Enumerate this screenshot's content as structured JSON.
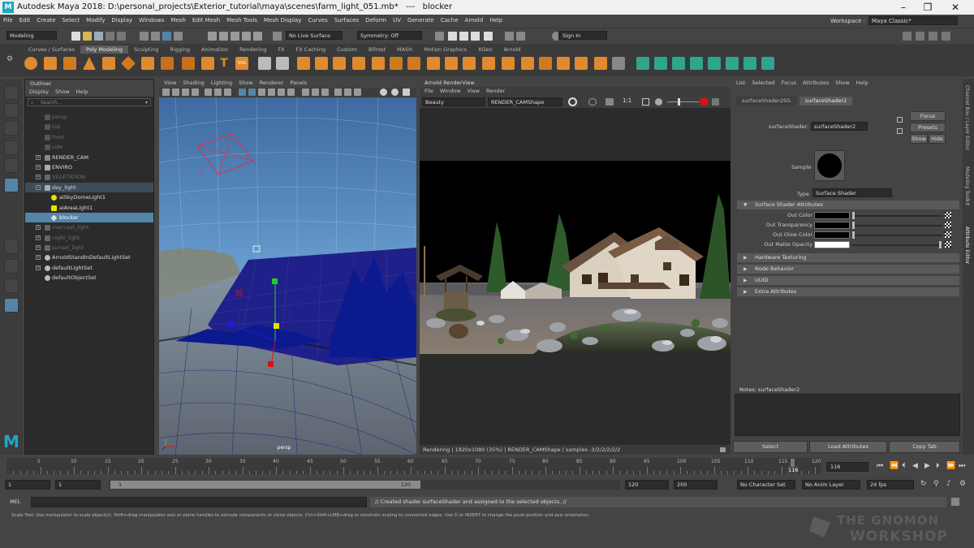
{
  "title_bar": {
    "text": "Autodesk Maya 2018: D:\\personal_projects\\Exterior_tutorial\\maya\\scenes\\farm_light_051.mb*   ---   blocker",
    "logo": "M"
  },
  "menu": {
    "items": [
      "File",
      "Edit",
      "Create",
      "Select",
      "Modify",
      "Display",
      "Windows",
      "Mesh",
      "Edit Mesh",
      "Mesh Tools",
      "Mesh Display",
      "Curves",
      "Surfaces",
      "Deform",
      "UV",
      "Generate",
      "Cache",
      "Arnold",
      "Help"
    ],
    "workspace_label": "Workspace :",
    "workspace_value": "Maya Classic*"
  },
  "status_line": {
    "mode": "Modeling",
    "live_surface": "No Live Surface",
    "symmetry": "Symmetry: Off",
    "sign_in": "Sign In"
  },
  "shelf": {
    "tabs": [
      "Curves / Surfaces",
      "Poly Modeling",
      "Sculpting",
      "Rigging",
      "Animation",
      "Rendering",
      "FX",
      "FX Caching",
      "Custom",
      "Bifrost",
      "MASH",
      "Motion Graphics",
      "XGen",
      "Arnold"
    ],
    "active_tab": "Poly Modeling",
    "text_icons": {
      "text": "T",
      "svg": "SVG"
    }
  },
  "outliner": {
    "title": "Outliner",
    "menu": [
      "Display",
      "Show",
      "Help"
    ],
    "search_placeholder": "Search...",
    "items": [
      {
        "label": "persp",
        "dim": true
      },
      {
        "label": "top",
        "dim": true
      },
      {
        "label": "front",
        "dim": true
      },
      {
        "label": "side",
        "dim": true
      },
      {
        "label": "RENDER_CAM"
      },
      {
        "label": "ENVIRO"
      },
      {
        "label": "VEGETATION",
        "dim": true
      },
      {
        "label": "day_light"
      },
      {
        "label": "aiSkyDomeLight1"
      },
      {
        "label": "aiAreaLight1"
      },
      {
        "label": "blocker",
        "selected": true
      },
      {
        "label": "overcast_light",
        "dim": true
      },
      {
        "label": "night_light",
        "dim": true
      },
      {
        "label": "sunset_light",
        "dim": true
      },
      {
        "label": "ArnoldStandInDefaultLightSet"
      },
      {
        "label": "defaultLightSet"
      },
      {
        "label": "defaultObjectSet"
      }
    ]
  },
  "viewport": {
    "menu": [
      "View",
      "Shading",
      "Lighting",
      "Show",
      "Renderer",
      "Panels"
    ],
    "camera_label": "persp"
  },
  "render_view": {
    "title": "Arnold RenderView",
    "menu": [
      "File",
      "Window",
      "View",
      "Render"
    ],
    "aov": "Beauty",
    "camera": "RENDER_CAMShape",
    "ratio": "1:1",
    "status": "Rendering | 1920x1080 (35%) | RENDER_CAMShape | samples -3/2/2/2/2/2"
  },
  "attribute_editor": {
    "menu": [
      "List",
      "Selected",
      "Focus",
      "Attributes",
      "Show",
      "Help"
    ],
    "tabs": [
      "surfaceShader2SG",
      "surfaceShader2"
    ],
    "active_tab": "surfaceShader2",
    "node_label": "surfaceShader:",
    "node_name": "surfaceShader2",
    "buttons": {
      "focus": "Focus",
      "presets": "Presets",
      "show": "Show",
      "hide": "Hide"
    },
    "sample_label": "Sample",
    "type_label": "Type",
    "type_value": "Surface Shader",
    "section_main": "Surface Shader Attributes",
    "attributes": [
      {
        "label": "Out Color",
        "color": "#000000",
        "value": 0.0
      },
      {
        "label": "Out Transparency",
        "color": "#000000",
        "value": 0.0
      },
      {
        "label": "Out Glow Color",
        "color": "#000000",
        "value": 0.0
      },
      {
        "label": "Out Matte Opacity",
        "color": "#ffffff",
        "value": 1.0
      }
    ],
    "collapsed_sections": [
      "Hardware Texturing",
      "Node Behavior",
      "UUID",
      "Extra Attributes"
    ],
    "notes_label": "Notes:  surfaceShader2",
    "bottom_buttons": [
      "Select",
      "Load Attributes",
      "Copy Tab"
    ]
  },
  "side_tabs": [
    "Channel Box / Layer Editor",
    "Modeling Toolkit",
    "Attribute Editor"
  ],
  "time_slider": {
    "ticks": [
      "5",
      "10",
      "15",
      "20",
      "25",
      "30",
      "35",
      "40",
      "45",
      "50",
      "55",
      "60",
      "65",
      "70",
      "75",
      "80",
      "85",
      "90",
      "95",
      "100",
      "105",
      "110",
      "115",
      "120"
    ],
    "current_frame": "116",
    "current_field": "116"
  },
  "range_bar": {
    "start": "1",
    "playback_start": "1",
    "range_start": "1",
    "range_end": "120",
    "playback_end": "120",
    "end": "200",
    "character": "No Character Set",
    "anim_layer": "No Anim Layer",
    "fps": "24 fps"
  },
  "command_line": {
    "lang": "MEL",
    "result": "// Created shader surfaceShader and assigned to the selected objects. //"
  },
  "help_line": "Scale Tool: Use manipulator to scale object(s). Shift+drag manipulator axis or plane handles to extrude components or clone objects. Ctrl+Shift+LMB+drag to constrain scaling to connected edges. Use D or INSERT to change the pivot position and axis orientation.",
  "watermark": {
    "line1": "THE GNOMON",
    "line2": "WORKSHOP"
  },
  "colors": {
    "selection": "#5285a6",
    "maya_blue": "#1ba9c4",
    "shelf_orange": "#e08a2e",
    "shelf_teal": "#2fa58d",
    "manip_red": "#e01010",
    "manip_green": "#20d020",
    "manip_blue": "#1a1ae0",
    "manip_yellow": "#e8e000"
  }
}
